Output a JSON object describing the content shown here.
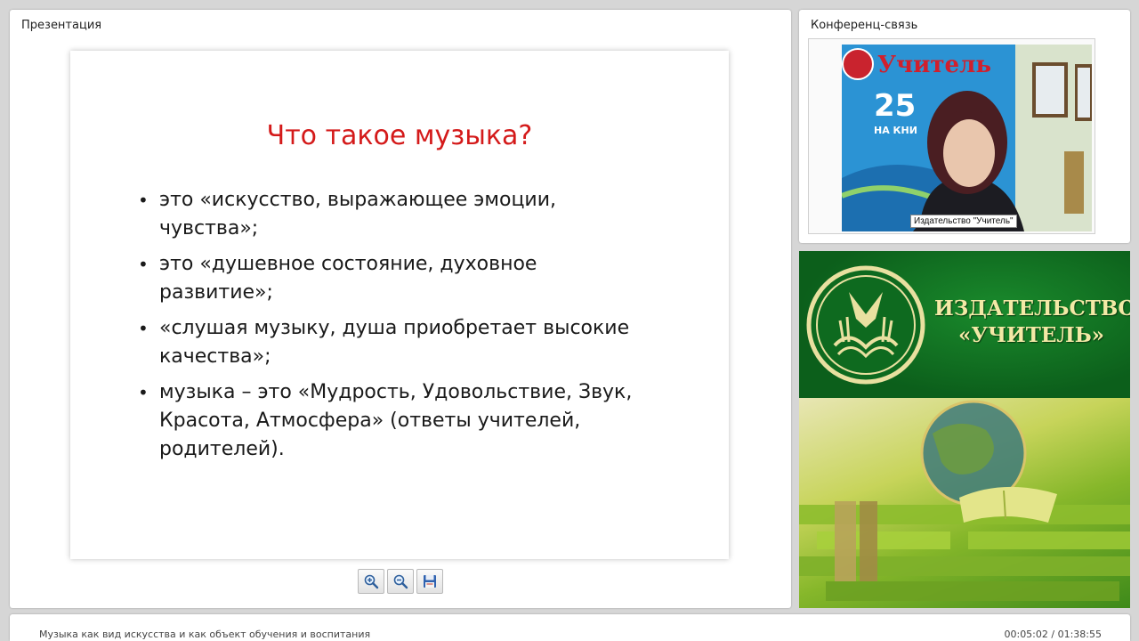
{
  "presentation": {
    "title": "Презентация",
    "slide": {
      "title": "Что такое музыка?",
      "bullets": [
        "это «искусство, выражающее эмоции, чувства»;",
        "это «душевное состояние, духовное развитие»;",
        " «слушая музыку, душа приобретает высокие качества»;",
        " музыка – это «Мудрость, Удовольствие, Звук, Красота, Атмосфера» (ответы учителей, родителей)."
      ]
    },
    "toolbar": [
      {
        "name": "zoom-in-button",
        "icon": "zoom-in-icon"
      },
      {
        "name": "zoom-out-button",
        "icon": "zoom-out-icon"
      },
      {
        "name": "save-button",
        "icon": "save-icon"
      }
    ]
  },
  "conference": {
    "title": "Конференц-связь",
    "video_caption": "Издательство \"Учитель\"",
    "backdrop_text": {
      "logo": "Учитель",
      "number": "25",
      "tagline": "НА КНИ"
    }
  },
  "brand": {
    "name_line1": "ИЗДАТЕЛЬСТВО",
    "name_line2": "«УЧИТЕЛЬ»"
  },
  "footer": {
    "title": "Музыка как вид искусства и как объект обучения и воспитания",
    "time": "00:05:02 / 01:38:55"
  },
  "colors": {
    "slide_title": "#d41a1a",
    "brand_green": "#0d6b1f",
    "brand_text": "#f3e9a6"
  }
}
